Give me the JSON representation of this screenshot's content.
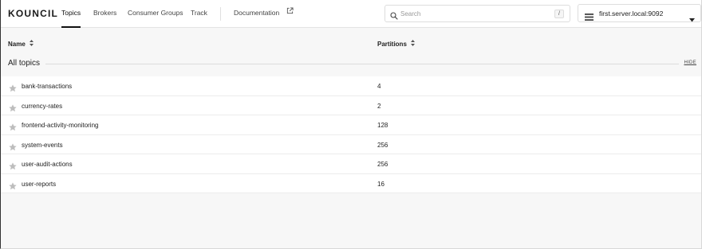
{
  "app": {
    "logo": "KOUNCIL"
  },
  "nav": {
    "items": [
      {
        "label": "Topics",
        "active": true
      },
      {
        "label": "Brokers",
        "active": false
      },
      {
        "label": "Consumer Groups",
        "active": false
      },
      {
        "label": "Track",
        "active": false
      }
    ],
    "documentation_label": "Documentation"
  },
  "search": {
    "placeholder": "Search",
    "value": "",
    "shortcut": "/"
  },
  "server": {
    "selected": "first.server.local:9092"
  },
  "table": {
    "columns": {
      "name": "Name",
      "partitions": "Partitions"
    },
    "group": {
      "title": "All topics",
      "hide_label": "HIDE"
    },
    "rows": [
      {
        "name": "bank-transactions",
        "partitions": "4"
      },
      {
        "name": "currency-rates",
        "partitions": "2"
      },
      {
        "name": "frontend-activity-monitoring",
        "partitions": "128"
      },
      {
        "name": "system-events",
        "partitions": "256"
      },
      {
        "name": "user-audit-actions",
        "partitions": "256"
      },
      {
        "name": "user-reports",
        "partitions": "16"
      }
    ]
  },
  "icons": {
    "external": "external-link-icon",
    "search": "search-icon",
    "server": "server-list-icon",
    "caret": "caret-down-icon",
    "sort": "sort-icon",
    "star": "star-icon"
  },
  "colors": {
    "text": "#222222",
    "star": "#bdbdbd",
    "background": "#f7f7f7",
    "row": "#ffffff"
  }
}
